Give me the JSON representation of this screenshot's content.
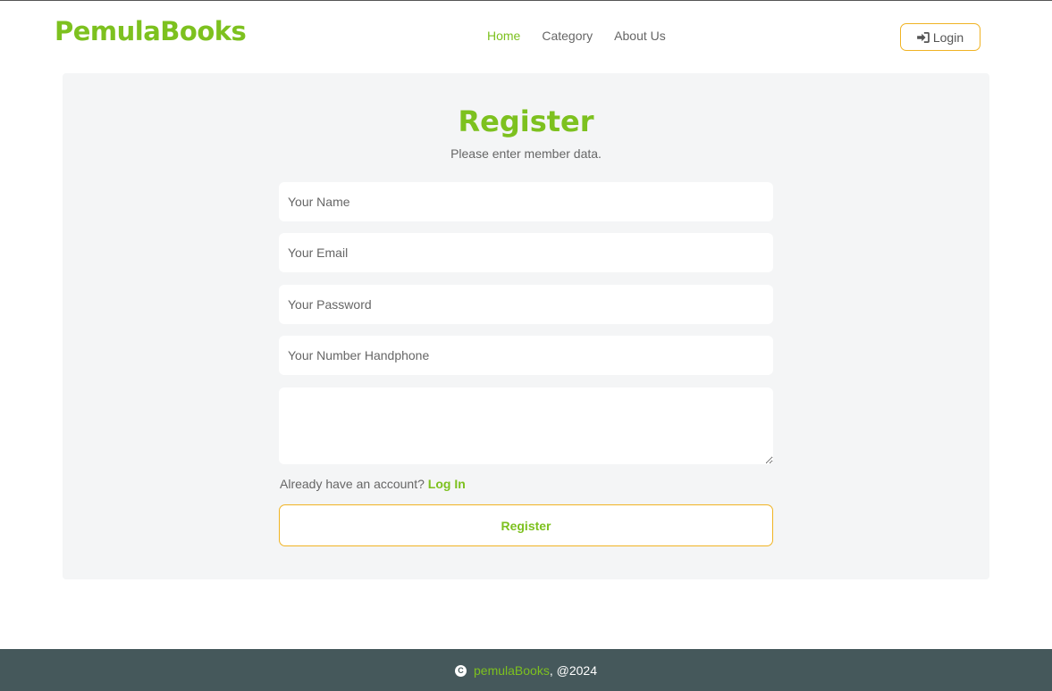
{
  "header": {
    "brand": "PemulaBooks",
    "nav": [
      {
        "label": "Home"
      },
      {
        "label": "Category"
      },
      {
        "label": "About Us"
      }
    ],
    "login_label": "Login"
  },
  "form": {
    "title": "Register",
    "subtitle": "Please enter member data.",
    "name_placeholder": "Your Name",
    "email_placeholder": "Your Email",
    "password_placeholder": "Your Password",
    "phone_placeholder": "Your Number Handphone",
    "already_text": "Already have an account?",
    "login_link": "Log In",
    "submit_label": "Register"
  },
  "footer": {
    "copy_symbol": "C",
    "brand": "pemulaBooks",
    "year_text": ", @2024"
  },
  "colors": {
    "accent": "#7dc11f",
    "button_border": "#f0b323",
    "footer_bg": "#45585b",
    "card_bg": "#f4f5f6"
  }
}
